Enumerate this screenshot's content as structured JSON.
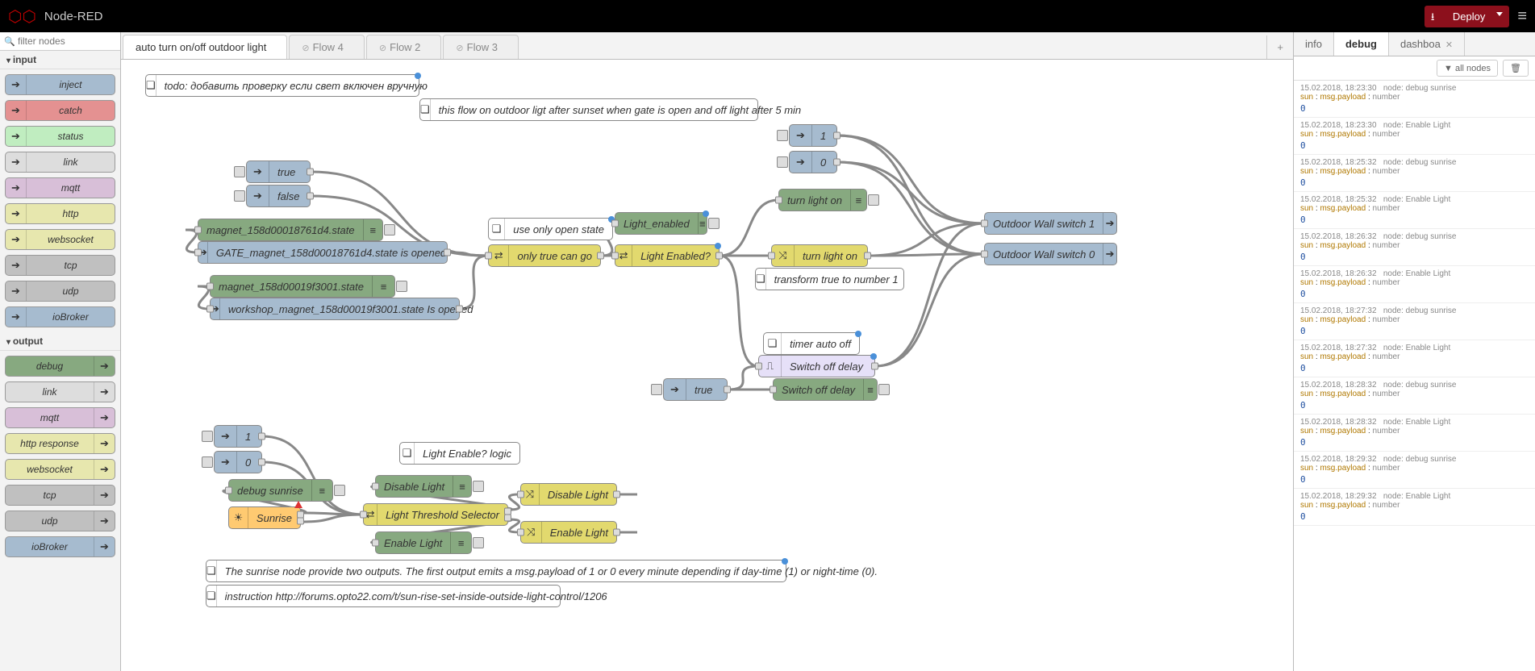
{
  "app": {
    "title": "Node-RED",
    "deploy_label": "Deploy"
  },
  "palette": {
    "search_placeholder": "filter nodes",
    "cat_input": "input",
    "cat_output": "output",
    "input_nodes": [
      "inject",
      "catch",
      "status",
      "link",
      "mqtt",
      "http",
      "websocket",
      "tcp",
      "udp",
      "ioBroker"
    ],
    "output_nodes": [
      "debug",
      "link",
      "mqtt",
      "http response",
      "websocket",
      "tcp",
      "udp",
      "ioBroker"
    ]
  },
  "tabs": {
    "items": [
      {
        "label": "auto turn on/off outdoor light",
        "active": true,
        "disabled": false
      },
      {
        "label": "Flow 4",
        "active": false,
        "disabled": true
      },
      {
        "label": "Flow 2",
        "active": false,
        "disabled": true
      },
      {
        "label": "Flow 3",
        "active": false,
        "disabled": true
      }
    ]
  },
  "nodes": {
    "comment1": "todo: добавить проверку если свет включен вручную",
    "comment2": "this flow on outdoor ligt after sunset when gate is open and off light after 5 min",
    "inj_true": "true",
    "inj_false": "false",
    "dbg_magnet1": "magnet_158d00018761d4.state",
    "iob_gate": "GATE_magnet_158d00018761d4.state is opened",
    "dbg_magnet2": "magnet_158d00019f3001.state",
    "iob_workshop": "workshop_magnet_158d00019f3001.state Is opened",
    "comment3": "use only open state",
    "sw_onlytrue": "only true can go",
    "dbg_lighten": "Light_enabled",
    "sw_lighten": "Light Enabled?",
    "inj_1": "1",
    "inj_0": "0",
    "dbg_turnon": "turn light on",
    "ch_turnon": "turn light on",
    "comment4": "transform true to number 1",
    "comment5": "timer auto off",
    "trg_switchoff": "Switch off delay",
    "inj_true2": "true",
    "dbg_switchoff": "Switch off delay",
    "iob_wall1": "Outdoor Wall switch 1",
    "iob_wall0": "Outdoor Wall switch 0",
    "inj_1b": "1",
    "inj_0b": "0",
    "comment6": "Light Enable? logic",
    "dbg_sunrise": "debug sunrise",
    "sunrise": "Sunrise",
    "dbg_disable": "Disable Light",
    "ch_disable": "Disable Light",
    "dbg_enable": "Enable Light",
    "ch_enable": "Enable Light",
    "sw_threshold": "Light Threshold Selector",
    "comment7": "The sunrise node provide two outputs. The first output emits a msg.payload of 1 or 0 every minute depending if day-time (1) or night-time (0).",
    "comment8": "instruction http://forums.opto22.com/t/sun-rise-set-inside-outside-light-control/1206"
  },
  "sidebar": {
    "tab_info": "info",
    "tab_debug": "debug",
    "tab_dash": "dashboa",
    "allnodes": "all nodes",
    "trash": "🗑"
  },
  "debug_msgs": [
    {
      "ts": "15.02.2018, 18:23:30",
      "node": "node: debug sunrise",
      "topic": "sun",
      "path": "msg.payload",
      "type": "number",
      "val": "0"
    },
    {
      "ts": "15.02.2018, 18:23:30",
      "node": "node: Enable Light",
      "topic": "sun",
      "path": "msg.payload",
      "type": "number",
      "val": "0"
    },
    {
      "ts": "15.02.2018, 18:25:32",
      "node": "node: debug sunrise",
      "topic": "sun",
      "path": "msg.payload",
      "type": "number",
      "val": "0"
    },
    {
      "ts": "15.02.2018, 18:25:32",
      "node": "node: Enable Light",
      "topic": "sun",
      "path": "msg.payload",
      "type": "number",
      "val": "0"
    },
    {
      "ts": "15.02.2018, 18:26:32",
      "node": "node: debug sunrise",
      "topic": "sun",
      "path": "msg.payload",
      "type": "number",
      "val": "0"
    },
    {
      "ts": "15.02.2018, 18:26:32",
      "node": "node: Enable Light",
      "topic": "sun",
      "path": "msg.payload",
      "type": "number",
      "val": "0"
    },
    {
      "ts": "15.02.2018, 18:27:32",
      "node": "node: debug sunrise",
      "topic": "sun",
      "path": "msg.payload",
      "type": "number",
      "val": "0"
    },
    {
      "ts": "15.02.2018, 18:27:32",
      "node": "node: Enable Light",
      "topic": "sun",
      "path": "msg.payload",
      "type": "number",
      "val": "0"
    },
    {
      "ts": "15.02.2018, 18:28:32",
      "node": "node: debug sunrise",
      "topic": "sun",
      "path": "msg.payload",
      "type": "number",
      "val": "0"
    },
    {
      "ts": "15.02.2018, 18:28:32",
      "node": "node: Enable Light",
      "topic": "sun",
      "path": "msg.payload",
      "type": "number",
      "val": "0"
    },
    {
      "ts": "15.02.2018, 18:29:32",
      "node": "node: debug sunrise",
      "topic": "sun",
      "path": "msg.payload",
      "type": "number",
      "val": "0"
    },
    {
      "ts": "15.02.2018, 18:29:32",
      "node": "node: Enable Light",
      "topic": "sun",
      "path": "msg.payload",
      "type": "number",
      "val": "0"
    }
  ]
}
